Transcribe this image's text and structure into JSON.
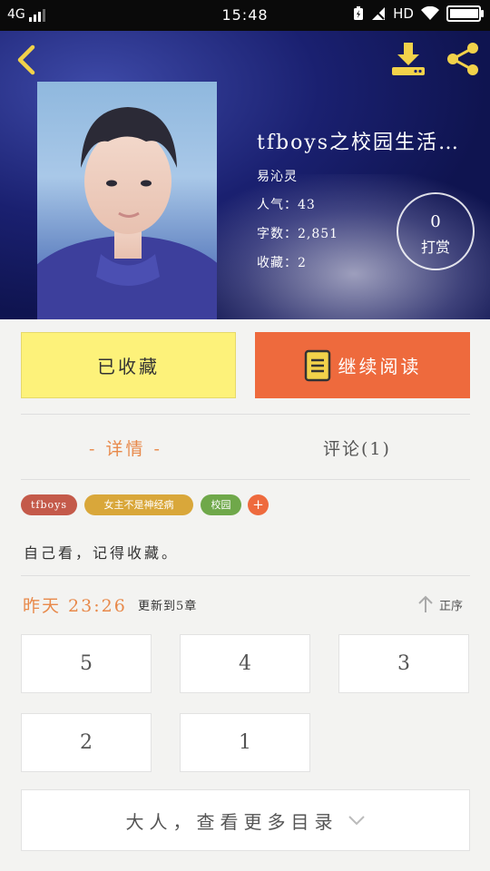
{
  "status_bar": {
    "network": "4G",
    "time": "15:48",
    "hd": "HD"
  },
  "header": {
    "icons": {
      "back": "back-icon",
      "download": "download-icon",
      "share": "share-icon"
    },
    "book_title": "tfboys之校园生活…",
    "author": "易沁灵",
    "popularity": "人气：43",
    "word_count": "字数：2,851",
    "favorites": "收藏：2",
    "tip": {
      "count": "0",
      "label": "打赏"
    }
  },
  "actions": {
    "collected_label": "已收藏",
    "continue_label": "继续阅读"
  },
  "tabs": {
    "detail": "- 详情 -",
    "comments": "评论(1)"
  },
  "tags": [
    "tfboys",
    "女主不是神经病",
    "校园",
    "+"
  ],
  "description": "自己看，记得收藏。",
  "update": {
    "time": "昨天 23:26",
    "text": "更新到5章",
    "sort_label": "正序"
  },
  "chapters": [
    "5",
    "4",
    "3",
    "2",
    "1"
  ],
  "more_label": "大人，查看更多目录",
  "colors": {
    "accent_orange": "#ee6a3d",
    "collected_yellow": "#fdf27a",
    "header_navy": "#1b2170",
    "tag_red": "#c45a4a",
    "tag_gold": "#d9a73a",
    "tag_green": "#6fa84a"
  }
}
